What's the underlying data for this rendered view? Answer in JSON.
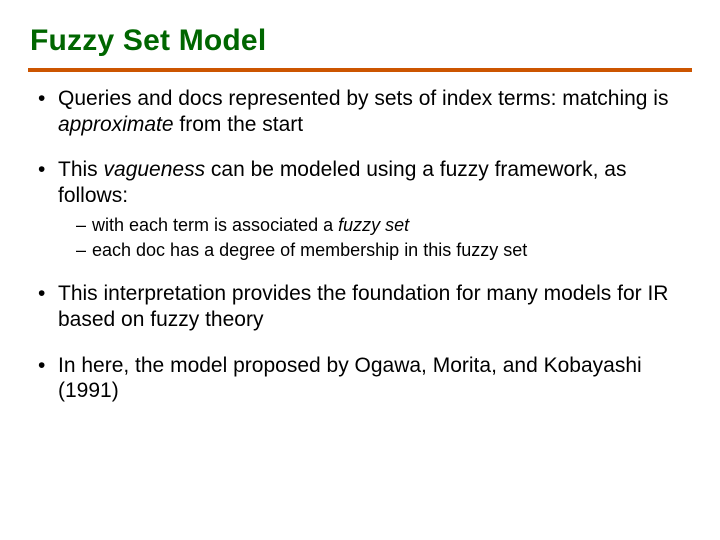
{
  "title": "Fuzzy Set Model",
  "bullets": [
    {
      "pre": "Queries and docs represented by sets of index terms: matching is ",
      "em": "approximate",
      "post": " from the start"
    },
    {
      "pre": "This ",
      "em": "vagueness",
      "post": " can be modeled using a fuzzy framework, as follows:",
      "sub": [
        {
          "pre": "with each term is associated a ",
          "em": "fuzzy set",
          "post": ""
        },
        {
          "pre": "each doc has a degree of membership in this fuzzy set",
          "em": "",
          "post": ""
        }
      ]
    },
    {
      "pre": "This interpretation provides the foundation for many models for IR based on fuzzy theory",
      "em": "",
      "post": ""
    },
    {
      "pre": "In here, the model proposed by Ogawa, Morita, and Kobayashi (1991)",
      "em": "",
      "post": ""
    }
  ]
}
